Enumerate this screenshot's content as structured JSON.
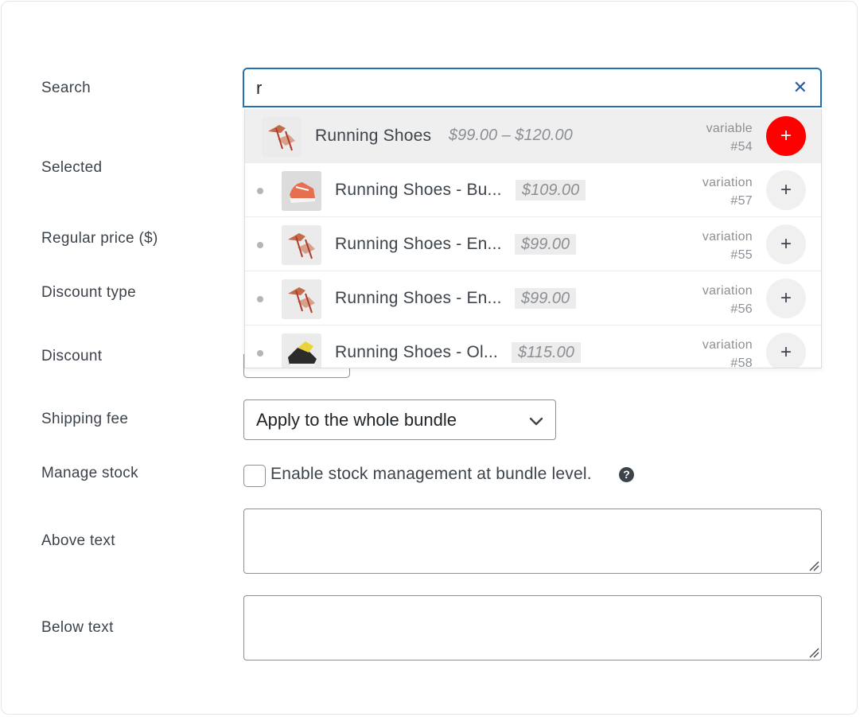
{
  "labels": {
    "search": "Search",
    "selected": "Selected",
    "regular_price": "Regular price ($)",
    "discount_type": "Discount type",
    "discount": "Discount",
    "shipping_fee": "Shipping fee",
    "manage_stock": "Manage stock",
    "above_text": "Above text",
    "below_text": "Below text"
  },
  "search": {
    "value": "r",
    "clear_icon": "close-icon",
    "results": [
      {
        "name": "Running Shoes",
        "price": "$99.00 – $120.00",
        "type": "variable",
        "id": "#54",
        "highlighted": true
      },
      {
        "name": "Running Shoes - Bu...",
        "price": "$109.00",
        "type": "variation",
        "id": "#57",
        "highlighted": false
      },
      {
        "name": "Running Shoes - En...",
        "price": "$99.00",
        "type": "variation",
        "id": "#55",
        "highlighted": false
      },
      {
        "name": "Running Shoes - En...",
        "price": "$99.00",
        "type": "variation",
        "id": "#56",
        "highlighted": false
      },
      {
        "name": "Running Shoes - Ol...",
        "price": "$115.00",
        "type": "variation",
        "id": "#58",
        "highlighted": false
      }
    ],
    "add_symbol": "+"
  },
  "shipping": {
    "selected": "Apply to the whole bundle"
  },
  "stock": {
    "checkbox_label": "Enable stock management at bundle level.",
    "checked": false,
    "help": "?"
  },
  "colors": {
    "accent": "#2271b1",
    "add_active": "#ff0000"
  }
}
